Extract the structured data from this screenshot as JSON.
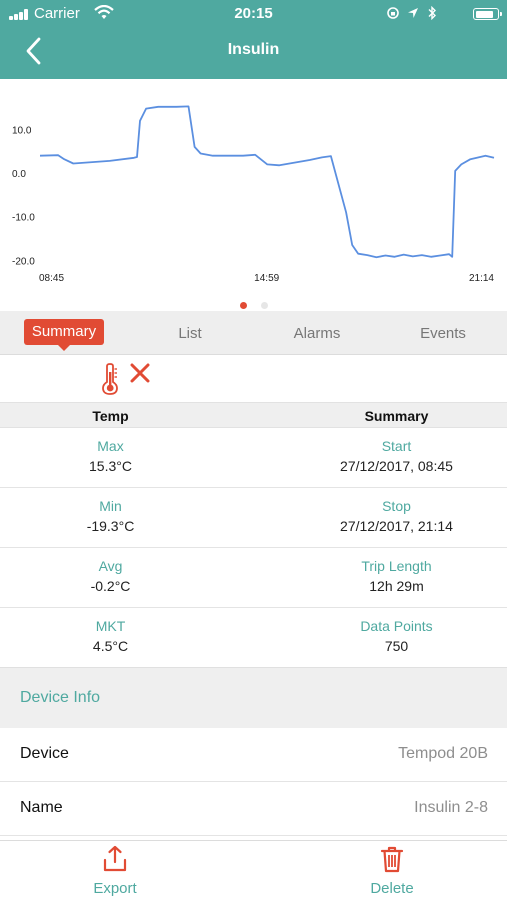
{
  "status_bar": {
    "carrier": "Carrier",
    "time": "20:15"
  },
  "nav": {
    "title": "Insulin"
  },
  "chart_data": {
    "type": "line",
    "ytick_labels": [
      "10.0",
      "0.0",
      "-10.0",
      "-20.0"
    ],
    "yticks": [
      10,
      0,
      -10,
      -20
    ],
    "xtick_labels": [
      "08:45",
      "14:59",
      "21:14"
    ],
    "ylim": [
      -22,
      17
    ],
    "grid": false,
    "color": "#5b8fe0",
    "series": [
      {
        "x": [
          "08:45",
          "09:15",
          "09:25",
          "09:40",
          "10:40",
          "11:20",
          "11:25",
          "11:30",
          "11:40",
          "12:00",
          "12:30",
          "12:50",
          "13:00",
          "13:10",
          "13:30",
          "14:20",
          "14:40",
          "15:00",
          "15:20",
          "16:10",
          "16:30",
          "16:45",
          "17:10",
          "17:20",
          "17:30",
          "17:45",
          "18:00",
          "18:15",
          "18:30",
          "18:45",
          "19:00",
          "19:15",
          "19:30",
          "19:45",
          "20:00",
          "20:05",
          "20:10",
          "20:20",
          "20:35",
          "21:00",
          "21:14"
        ],
        "y": [
          4.0,
          4.1,
          3.2,
          2.2,
          2.8,
          3.5,
          3.7,
          12.0,
          14.8,
          15.2,
          15.2,
          15.3,
          6.0,
          4.5,
          4.0,
          4.0,
          4.2,
          2.0,
          1.8,
          3.0,
          3.6,
          3.9,
          -9.0,
          -16.5,
          -18.5,
          -18.8,
          -19.3,
          -18.9,
          -19.2,
          -18.7,
          -19.1,
          -18.8,
          -19.2,
          -18.9,
          -18.6,
          -19.2,
          0.5,
          2.0,
          3.2,
          4.0,
          3.5
        ]
      }
    ]
  },
  "pager": {
    "active": 0,
    "count": 2
  },
  "tabs": [
    {
      "label": "Summary",
      "active": true
    },
    {
      "label": "List",
      "active": false
    },
    {
      "label": "Alarms",
      "active": false
    },
    {
      "label": "Events",
      "active": false
    }
  ],
  "filter": {
    "icons": [
      "thermometer-icon",
      "close-icon"
    ],
    "accent": "#e14b34"
  },
  "stats": {
    "headers": [
      "Temp",
      "Summary"
    ],
    "rows": [
      {
        "left_label": "Max",
        "left_value": "15.3°C",
        "right_label": "Start",
        "right_value": "27/12/2017, 08:45"
      },
      {
        "left_label": "Min",
        "left_value": "-19.3°C",
        "right_label": "Stop",
        "right_value": "27/12/2017, 21:14"
      },
      {
        "left_label": "Avg",
        "left_value": "-0.2°C",
        "right_label": "Trip Length",
        "right_value": "12h 29m"
      },
      {
        "left_label": "MKT",
        "left_value": "4.5°C",
        "right_label": "Data Points",
        "right_value": "750"
      }
    ]
  },
  "device_info": {
    "title": "Device Info",
    "rows": [
      {
        "label": "Device",
        "value": "Tempod 20B"
      },
      {
        "label": "Name",
        "value": "Insulin 2-8"
      }
    ]
  },
  "actions": {
    "export_label": "Export",
    "delete_label": "Delete"
  },
  "colors": {
    "nav": "#4fa9a0",
    "accent": "#e14b34",
    "label": "#4fa9a0",
    "series": "#5b8fe0"
  }
}
